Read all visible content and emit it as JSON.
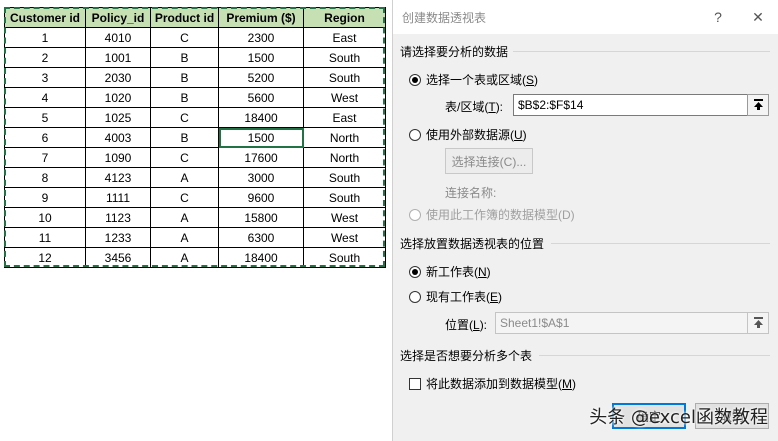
{
  "table": {
    "headers": [
      "Customer id",
      "Policy_id",
      "Product id",
      "Premium ($)",
      "Region"
    ],
    "rows": [
      [
        "1",
        "4010",
        "C",
        "2300",
        "East"
      ],
      [
        "2",
        "1001",
        "B",
        "1500",
        "South"
      ],
      [
        "3",
        "2030",
        "B",
        "5200",
        "South"
      ],
      [
        "4",
        "1020",
        "B",
        "5600",
        "West"
      ],
      [
        "5",
        "1025",
        "C",
        "18400",
        "East"
      ],
      [
        "6",
        "4003",
        "B",
        "1500",
        "North"
      ],
      [
        "7",
        "1090",
        "C",
        "17600",
        "North"
      ],
      [
        "8",
        "4123",
        "A",
        "3000",
        "South"
      ],
      [
        "9",
        "1111",
        "C",
        "9600",
        "South"
      ],
      [
        "10",
        "1123",
        "A",
        "15800",
        "West"
      ],
      [
        "11",
        "1233",
        "A",
        "6300",
        "West"
      ],
      [
        "12",
        "3456",
        "A",
        "18400",
        "South"
      ]
    ],
    "header_color": "#c6e0b4",
    "marquee_color": "#217346"
  },
  "dialog": {
    "title": "创建数据透视表",
    "help_label": "?",
    "close_label": "✕",
    "section_source": "请选择要分析的数据",
    "radio_table_range": "选择一个表或区域(",
    "radio_table_range_key": "S",
    "range_label_pre": "表/区域(",
    "range_label_key": "T",
    "range_label_post": "):",
    "range_value": "$B$2:$F$14",
    "radio_external": "使用外部数据源(",
    "radio_external_key": "U",
    "choose_connection": "选择连接(C)...",
    "connection_name_label": "连接名称:",
    "radio_data_model": "使用此工作簿的数据模型(D)",
    "section_location": "选择放置数据透视表的位置",
    "radio_new_sheet": "新工作表(",
    "radio_new_sheet_key": "N",
    "radio_existing_sheet": "现有工作表(",
    "radio_existing_sheet_key": "E",
    "location_label_pre": "位置(",
    "location_label_key": "L",
    "location_label_post": "):",
    "location_value": "Sheet1!$A$1",
    "section_multi": "选择是否想要分析多个表",
    "add_to_model_label": "将此数据添加到数据模型(",
    "add_to_model_key": "M",
    "ok_label": "确定",
    "cancel_label": "取消",
    "accent_color": "#0078d7"
  },
  "watermark": "头条 @excel函数教程"
}
